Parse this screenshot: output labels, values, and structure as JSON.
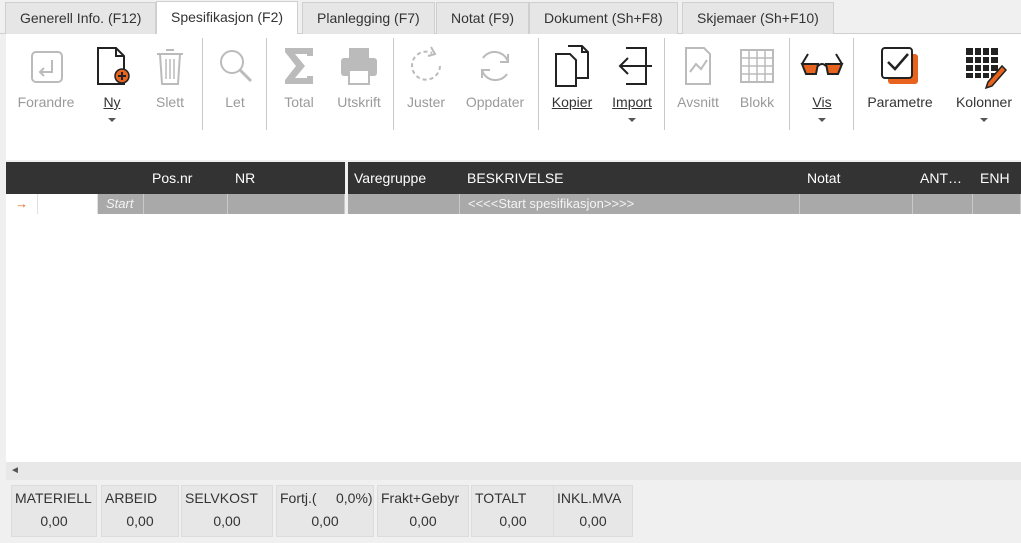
{
  "tabs": [
    {
      "label": "Generell Info. (F12)"
    },
    {
      "label": "Spesifikasjon (F2)"
    },
    {
      "label": "Planlegging (F7)"
    },
    {
      "label": "Notat (F9)"
    },
    {
      "label": "Dokument (Sh+F8)"
    },
    {
      "label": "Skjemaer (Sh+F10)"
    }
  ],
  "toolbar": {
    "forandre": "Forandre",
    "ny": "Ny",
    "slett": "Slett",
    "let": "Let",
    "total": "Total",
    "utskrift": "Utskrift",
    "juster": "Juster",
    "oppdater": "Oppdater",
    "kopier": "Kopier",
    "import": "Import",
    "avsnitt": "Avsnitt",
    "blokk": "Blokk",
    "vis": "Vis",
    "parametre": "Parametre",
    "kolonner": "Kolonner"
  },
  "grid": {
    "columns": {
      "posnr": "Pos.nr",
      "nr": "NR",
      "varegruppe": "Varegruppe",
      "beskrivelse": "BESKRIVELSE",
      "notat": "Notat",
      "antall": "ANT…",
      "enh": "ENH"
    },
    "row": {
      "marker": "→",
      "type": "Start",
      "description": "<<<<Start spesifikasjon>>>>"
    }
  },
  "scroll": {
    "left_arrow": "◄"
  },
  "totals": [
    {
      "label": "MATERIELL",
      "value": "0,00"
    },
    {
      "label": "ARBEID",
      "value": "0,00"
    },
    {
      "label": "SELVKOST",
      "value": "0,00"
    },
    {
      "label": "Fortj.(     0,0%)",
      "value": "0,00"
    },
    {
      "label": "Frakt+Gebyr",
      "value": "0,00"
    },
    {
      "label": "TOTALT",
      "value": "0,00"
    },
    {
      "label": "INKL.MVA",
      "value": "0,00"
    }
  ],
  "colors": {
    "accent": "#e8641e",
    "header_bg": "#333333",
    "row_gray": "#a9a9a9"
  }
}
